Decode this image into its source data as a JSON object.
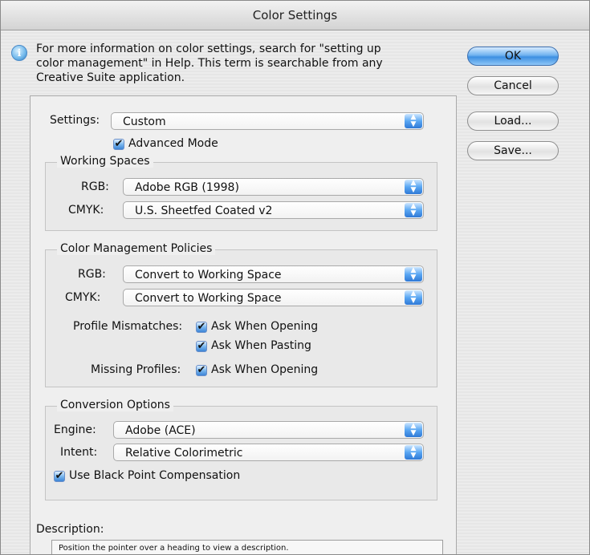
{
  "window": {
    "title": "Color Settings"
  },
  "info": {
    "line1": "For more information on color settings, search for \"setting up",
    "line2": "color management\" in Help. This term is searchable from any",
    "line3": "Creative Suite application."
  },
  "buttons": {
    "ok": "OK",
    "cancel": "Cancel",
    "load": "Load...",
    "save": "Save..."
  },
  "settings": {
    "label": "Settings:",
    "value": "Custom",
    "advanced_mode": {
      "label": "Advanced Mode",
      "checked": true
    }
  },
  "working_spaces": {
    "title": "Working Spaces",
    "rgb_label": "RGB:",
    "rgb_value": "Adobe RGB (1998)",
    "cmyk_label": "CMYK:",
    "cmyk_value": "U.S. Sheetfed Coated v2"
  },
  "policies": {
    "title": "Color Management Policies",
    "rgb_label": "RGB:",
    "rgb_value": "Convert to Working Space",
    "cmyk_label": "CMYK:",
    "cmyk_value": "Convert to Working Space",
    "profile_mismatches_label": "Profile Mismatches:",
    "ask_when_opening": "Ask When Opening",
    "ask_when_pasting": "Ask When Pasting",
    "missing_profiles_label": "Missing Profiles:",
    "missing_ask_when_opening": "Ask When Opening"
  },
  "conversion": {
    "title": "Conversion Options",
    "engine_label": "Engine:",
    "engine_value": "Adobe (ACE)",
    "intent_label": "Intent:",
    "intent_value": "Relative Colorimetric",
    "black_point": "Use Black Point Compensation"
  },
  "description": {
    "label": "Description:",
    "text": "Position the pointer over a heading to view a description."
  },
  "icons": {
    "info": "info-icon",
    "checkbox": "checkmark-icon",
    "popup_arrows": "up-down-arrows-icon"
  }
}
